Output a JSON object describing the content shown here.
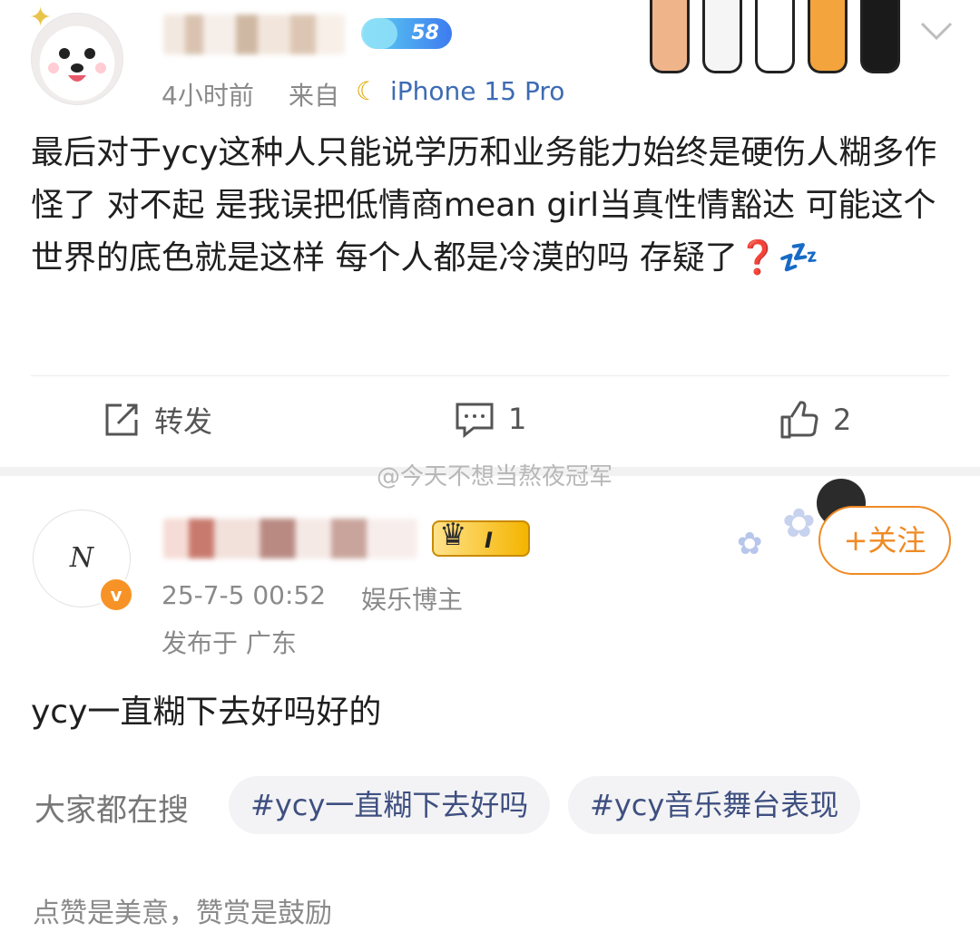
{
  "post1": {
    "vip_level": "58",
    "time": "4小时前",
    "source_prefix": "来自",
    "source_device": "iPhone 15 Pro",
    "text": "最后对于ycy这种人只能说学历和业务能力始终是硬伤人糊多作怪了 对不起 是我误把低情商mean girl当真性情豁达 可能这个世界的底色就是这样 每个人都是冷漠的吗 存疑了❓💤",
    "actions": {
      "repost_label": "转发",
      "comment_count": "1",
      "like_count": "2"
    }
  },
  "watermark": "@今天不想当熬夜冠军",
  "post2": {
    "avatar_letter": "N",
    "verify_mark": "v",
    "fan_level": "I",
    "time": "25-7-5 00:52",
    "role": "娱乐博主",
    "location": "发布于 广东",
    "follow_label": "+关注",
    "text": "ycy一直糊下去好吗好的",
    "search_label": "大家都在搜",
    "chips": [
      "#ycy一直糊下去好吗",
      "#ycy音乐舞台表现"
    ],
    "footer": "点赞是美意，赞赏是鼓励"
  },
  "icons": [
    "chevron-down-icon",
    "repost-icon",
    "comment-icon",
    "like-icon",
    "paw-sticker-icon",
    "flower-decor-icon"
  ],
  "colors": {
    "accent_orange": "#f08a24",
    "link_blue": "#3e4f80",
    "vip_blue": "#3d7bf0",
    "muted": "#8a8a8a"
  }
}
